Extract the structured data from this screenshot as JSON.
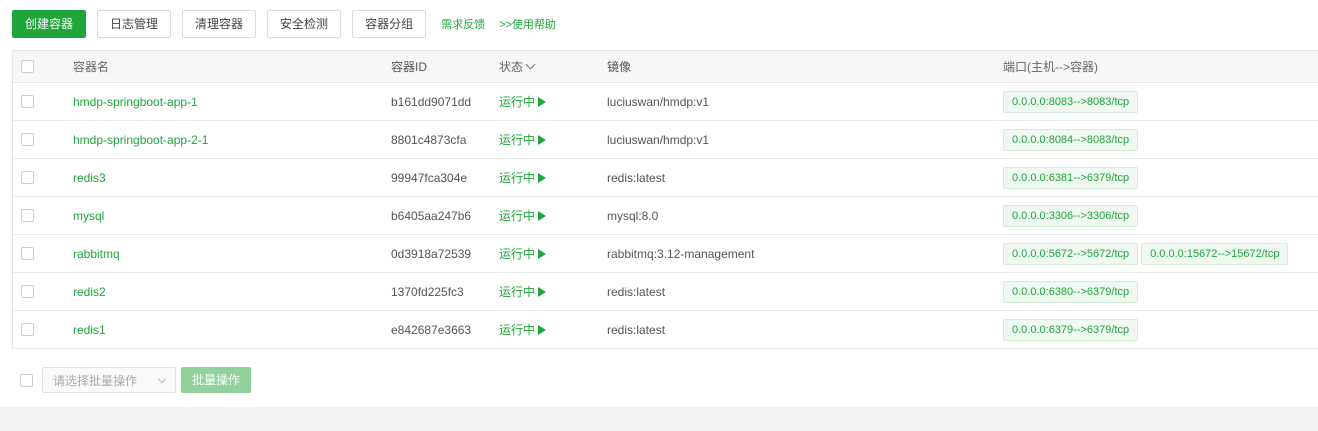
{
  "toolbar": {
    "create": "创建容器",
    "logs": "日志管理",
    "cleanup": "清理容器",
    "security": "安全检测",
    "groups": "容器分组",
    "feedback": "需求反馈",
    "help": ">>使用帮助"
  },
  "table": {
    "headers": {
      "name": "容器名",
      "id": "容器ID",
      "status": "状态",
      "image": "镜像",
      "ports": "端口(主机-->容器)"
    },
    "rows": [
      {
        "name": "hmdp-springboot-app-1",
        "id": "b161dd9071dd",
        "status": "运行中",
        "image": "luciuswan/hmdp:v1",
        "ports": [
          "0.0.0.0:8083-->8083/tcp"
        ]
      },
      {
        "name": "hmdp-springboot-app-2-1",
        "id": "8801c4873cfa",
        "status": "运行中",
        "image": "luciuswan/hmdp:v1",
        "ports": [
          "0.0.0.0:8084-->8083/tcp"
        ]
      },
      {
        "name": "redis3",
        "id": "99947fca304e",
        "status": "运行中",
        "image": "redis:latest",
        "ports": [
          "0.0.0.0:6381-->6379/tcp"
        ]
      },
      {
        "name": "mysql",
        "id": "b6405aa247b6",
        "status": "运行中",
        "image": "mysql:8.0",
        "ports": [
          "0.0.0.0:3306-->3306/tcp"
        ]
      },
      {
        "name": "rabbitmq",
        "id": "0d3918a72539",
        "status": "运行中",
        "image": "rabbitmq:3.12-management",
        "ports": [
          "0.0.0.0:5672-->5672/tcp",
          "0.0.0.0:15672-->15672/tcp"
        ]
      },
      {
        "name": "redis2",
        "id": "1370fd225fc3",
        "status": "运行中",
        "image": "redis:latest",
        "ports": [
          "0.0.0.0:6380-->6379/tcp"
        ]
      },
      {
        "name": "redis1",
        "id": "e842687e3663",
        "status": "运行中",
        "image": "redis:latest",
        "ports": [
          "0.0.0.0:6379-->6379/tcp"
        ]
      }
    ]
  },
  "footer": {
    "batch_select_placeholder": "请选择批量操作",
    "batch_button": "批量操作"
  },
  "colors": {
    "accent": "#20a53a",
    "tag_bg": "#f0f9f1"
  }
}
